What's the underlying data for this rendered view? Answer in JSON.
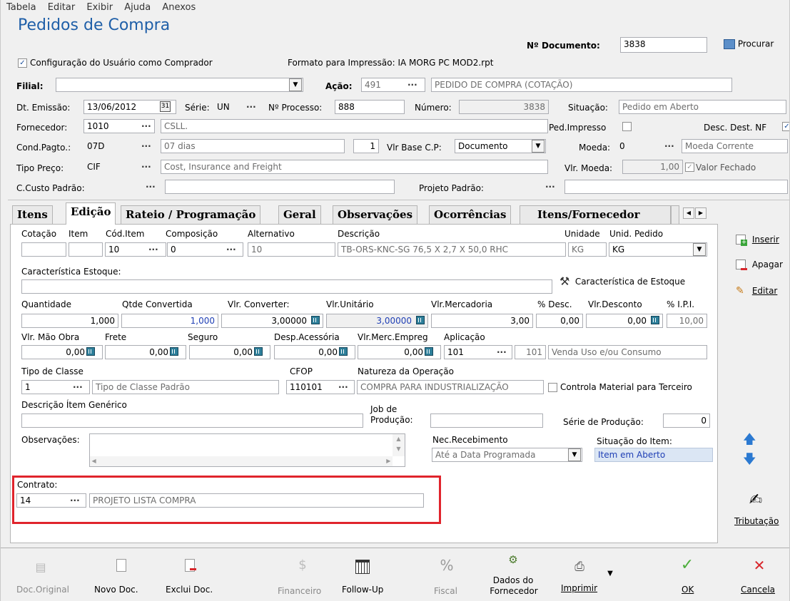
{
  "menu": [
    "Tabela",
    "Editar",
    "Exibir",
    "Ajuda",
    "Anexos"
  ],
  "title": "Pedidos de Compra",
  "header": {
    "doc_label": "Nº Documento:",
    "doc_value": "3838",
    "search": "Procurar",
    "config_user": "Configuração do Usuário como Comprador",
    "print_format": "Formato para Impressão: IA MORG PC MOD2.rpt"
  },
  "row_filial": {
    "filial": "Filial:",
    "acao": "Ação:",
    "acao_code": "491",
    "acao_desc": "PEDIDO DE COMPRA (COTAÇÃO)"
  },
  "row_emissao": {
    "dt_label": "Dt. Emissão:",
    "dt_value": "13/06/2012",
    "serie_label": "Série:",
    "serie_value": "UN",
    "proc_label": "Nº Processo:",
    "proc_value": "888",
    "numero_label": "Número:",
    "numero_value": "3838",
    "situacao_label": "Situação:",
    "situacao_value": "Pedido em Aberto"
  },
  "row_fornecedor": {
    "label": "Fornecedor:",
    "code": "1010",
    "desc": "CSLL.",
    "ped_impresso": "Ped.Impresso",
    "desc_dest": "Desc. Dest. NF"
  },
  "row_cond": {
    "label": "Cond.Pagto.:",
    "code": "07D",
    "desc": "07 dias",
    "num": "1",
    "vlr_base_label": "Vlr Base C.P:",
    "vlr_base_value": "Documento",
    "moeda_label": "Moeda:",
    "moeda_code": "0",
    "moeda_desc": "Moeda Corrente"
  },
  "row_tipo": {
    "label": "Tipo Preço:",
    "code": "CIF",
    "desc": "Cost, Insurance and Freight",
    "vlr_moeda_label": "Vlr. Moeda:",
    "vlr_moeda_value": "1,00",
    "valor_fechado": "Valor Fechado"
  },
  "row_ccusto": {
    "label": "C.Custo Padrão:",
    "projeto_label": "Projeto Padrão:"
  },
  "tabs": [
    "Itens",
    "Edição",
    "Rateio / Programação",
    "Geral",
    "Observações",
    "Ocorrências",
    "Itens/Fornecedor"
  ],
  "edicao": {
    "cotacao": "Cotação",
    "item": "Item",
    "cod_item": "Cód.Item",
    "cod_item_value": "10",
    "composicao": "Composição",
    "composicao_value": "0",
    "alternativo": "Alternativo",
    "alternativo_value": "10",
    "descricao": "Descrição",
    "descricao_value": "TB-ORS-KNC-SG 76,5 X 2,7 X 50,0 RHC",
    "unidade": "Unidade",
    "unidade_value": "KG",
    "unid_pedido": "Unid. Pedido",
    "unid_pedido_value": "KG",
    "caract_estoque": "Característica Estoque:",
    "caract_btn": "Característica de Estoque",
    "quantidade": "Quantidade",
    "quantidade_value": "1,000",
    "qtde_conv": "Qtde Convertida",
    "qtde_conv_value": "1,000",
    "vlr_conv": "Vlr. Converter:",
    "vlr_conv_value": "3,00000",
    "vlr_unit": "Vlr.Unitário",
    "vlr_unit_value": "3,00000",
    "vlr_merc": "Vlr.Mercadoria",
    "vlr_merc_value": "3,00",
    "desc_pct": "% Desc.",
    "desc_pct_value": "0,00",
    "vlr_desc": "Vlr.Desconto",
    "vlr_desc_value": "0,00",
    "ipi": "% I.P.I.",
    "ipi_value": "10,00",
    "mao_obra": "Vlr. Mão Obra",
    "mao_obra_value": "0,00",
    "frete": "Frete",
    "frete_value": "0,00",
    "seguro": "Seguro",
    "seguro_value": "0,00",
    "desp": "Desp.Acessória",
    "desp_value": "0,00",
    "vlr_merc_emp": "Vlr.Merc.Empreg",
    "vlr_merc_emp_value": "0,00",
    "aplicacao": "Aplicação",
    "aplicacao_code": "101",
    "aplicacao_num": "101",
    "aplicacao_desc": "Venda Uso e/ou Consumo",
    "tipo_classe": "Tipo de Classe",
    "tipo_classe_code": "1",
    "tipo_classe_desc": "Tipo de Classe Padrão",
    "cfop": "CFOP",
    "cfop_value": "110101",
    "natureza": "Natureza da Operação",
    "natureza_value": "COMPRA PARA INDUSTRIALIZAÇÃO",
    "controla": "Controla Material para Terceiro",
    "desc_generico": "Descrição Ítem Genérico",
    "job_1": "Job de",
    "job_2": "Produção:",
    "serie_prod": "Série de Produção:",
    "serie_prod_value": "0",
    "observacoes": "Observações:",
    "nec_receb": "Nec.Recebimento",
    "nec_receb_value": "Até a Data Programada",
    "situacao_item": "Situação do Item:",
    "situacao_item_value": "Item em Aberto",
    "contrato": "Contrato:",
    "contrato_code": "14",
    "contrato_desc": "PROJETO LISTA COMPRA"
  },
  "side": {
    "inserir": "Inserir",
    "apagar": "Apagar",
    "editar": "Editar",
    "tributacao": "Tributação"
  },
  "toolbar": {
    "doc_original": "Doc.Original",
    "novo_doc": "Novo Doc.",
    "exclui_doc": "Exclui Doc.",
    "financeiro": "Financeiro",
    "follow_up": "Follow-Up",
    "fiscal": "Fiscal",
    "dados_1": "Dados do",
    "dados_2": "Fornecedor",
    "imprimir": "Imprimir",
    "ok": "OK",
    "cancela": "Cancela"
  },
  "colors": {
    "title": "#1f5fa8",
    "highlight": "#e0242c",
    "calc": "#2d7f9a"
  }
}
